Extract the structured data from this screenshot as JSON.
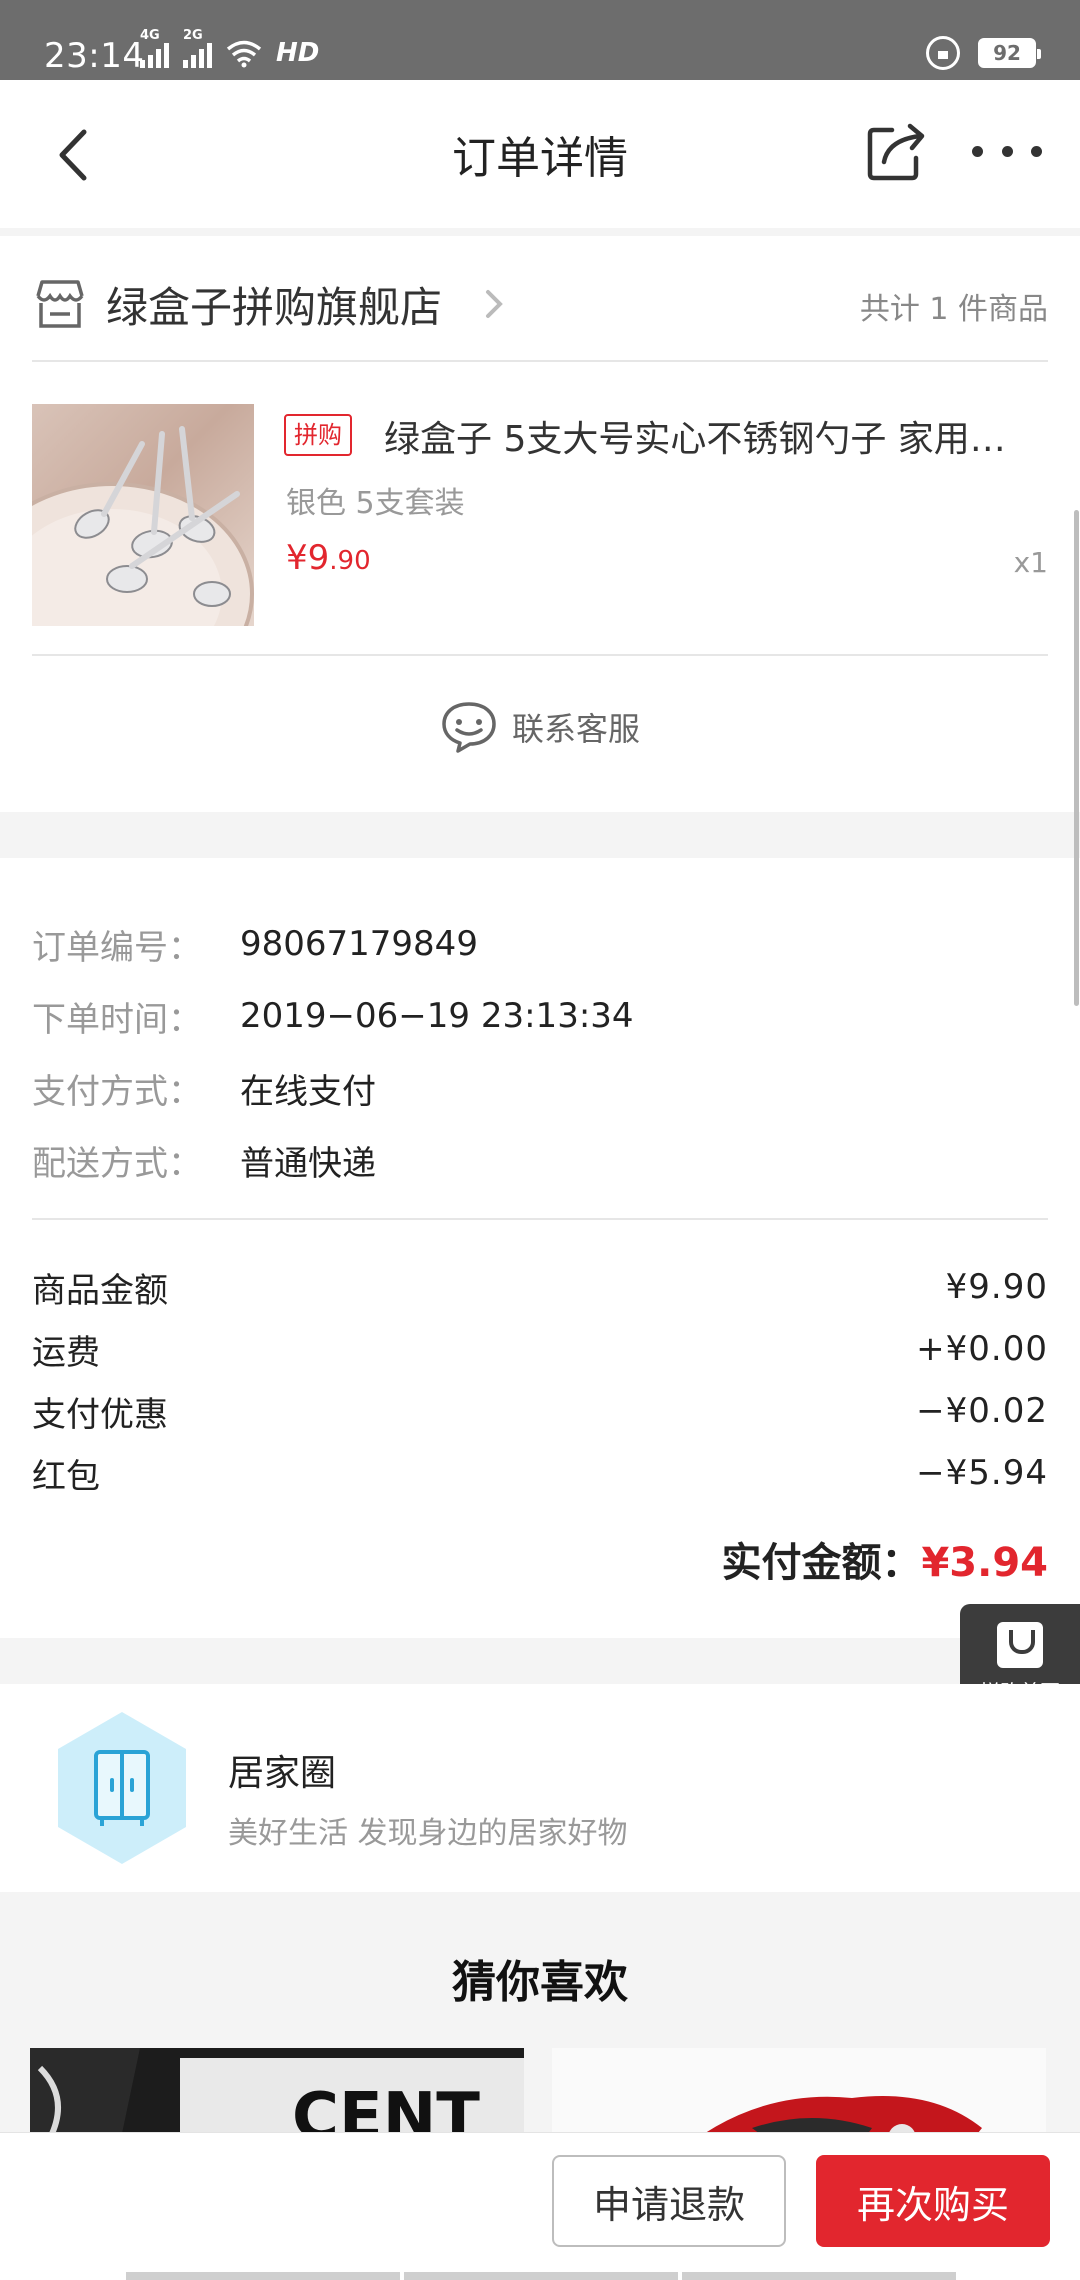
{
  "status_bar": {
    "time": "23:14",
    "net_labels": [
      "4G",
      "2G"
    ],
    "hd_label": "HD",
    "battery": "92"
  },
  "header": {
    "title": "订单详情",
    "icons": [
      "back-arrow-icon",
      "share-icon",
      "more-icon"
    ]
  },
  "store": {
    "name": "绿盒子拼购旗舰店",
    "item_count": "共计 1 件商品"
  },
  "product": {
    "tag": "拼购",
    "title": "绿盒子 5支大号实心不锈钢勺子 家用…",
    "spec": "银色 5支套装",
    "price_symbol": "¥",
    "price_int": "9",
    "price_dec": ".90",
    "quantity": "x1"
  },
  "service": {
    "label": "联系客服"
  },
  "order_info": [
    {
      "label": "订单编号：",
      "value": "98067179849"
    },
    {
      "label": "下单时间：",
      "value": "2019−06−19 23:13:34"
    },
    {
      "label": "支付方式：",
      "value": "在线支付"
    },
    {
      "label": "配送方式：",
      "value": "普通快递"
    }
  ],
  "amounts": [
    {
      "label": "商品金额",
      "value": "¥9.90"
    },
    {
      "label": "运费",
      "value": "+¥0.00"
    },
    {
      "label": "支付优惠",
      "value": "−¥0.02"
    },
    {
      "label": "红包",
      "value": "−¥5.94"
    }
  ],
  "paid": {
    "label": "实付金额：",
    "value": "¥3.94"
  },
  "float_home": {
    "label": "拼购首页"
  },
  "home_circle": {
    "title": "居家圈",
    "subtitle": "美好生活 发现身边的居家好物"
  },
  "recommend": {
    "title": "猜你喜欢",
    "img1_text": "CENT"
  },
  "bottom": {
    "refund": "申请退款",
    "rebuy": "再次购买"
  },
  "colors": {
    "accent": "#e2262e",
    "status_bar": "#6d6d6d",
    "background": "#f4f4f4"
  }
}
